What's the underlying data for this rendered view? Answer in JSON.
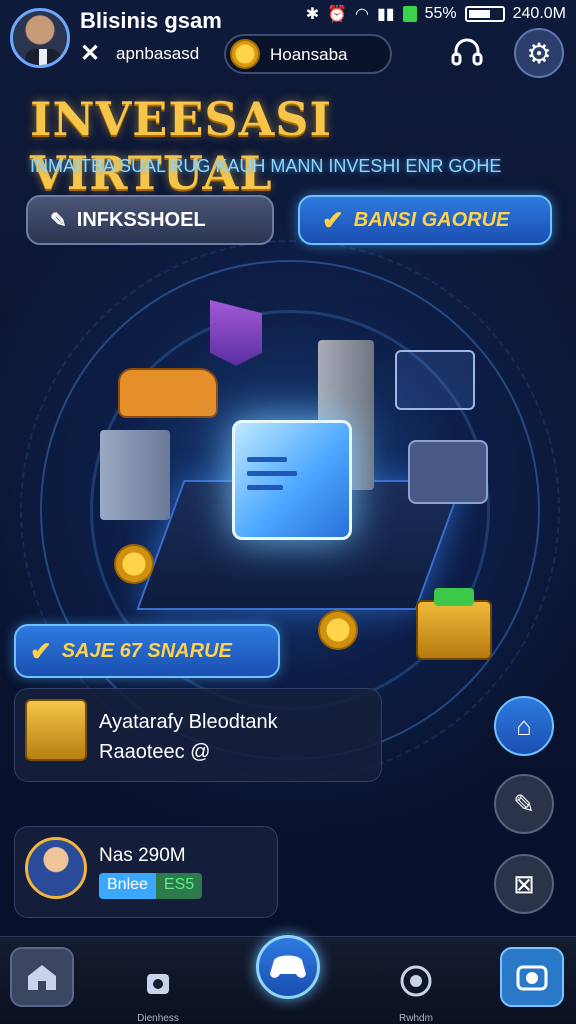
{
  "header": {
    "game_title": "Blisinis gsam",
    "account_label": "apnbasasd",
    "search_label": "Hoansaba",
    "close_icon": "close-icon",
    "support_icon": "headset-icon",
    "settings_icon": "gear-icon"
  },
  "status": {
    "time": "240.0M",
    "battery": "55%"
  },
  "hero": {
    "title": "INVEESASI VIRTUAL",
    "subtitle": "INMAITBA SUAL RUG KAUH MANN INVESHI ENR GOHE",
    "left_button": "INFKSSHOEL",
    "right_button": "BANSI GAORUE"
  },
  "actions": {
    "save_button": "SAJE 67 SNARUE"
  },
  "info_card": {
    "title": "Ayatarafy Bleodtank",
    "subtitle": "Raaoteec @"
  },
  "player": {
    "name": "Nas 290M",
    "tag_a": "Bnlee",
    "tag_b": "ES5"
  },
  "bottom_nav": {
    "shop_label": "Dienhess",
    "game_label": "Rwhdm"
  },
  "colors": {
    "accent": "#2f7ae0",
    "gold": "#f6c54a",
    "bg": "#0b1530"
  }
}
